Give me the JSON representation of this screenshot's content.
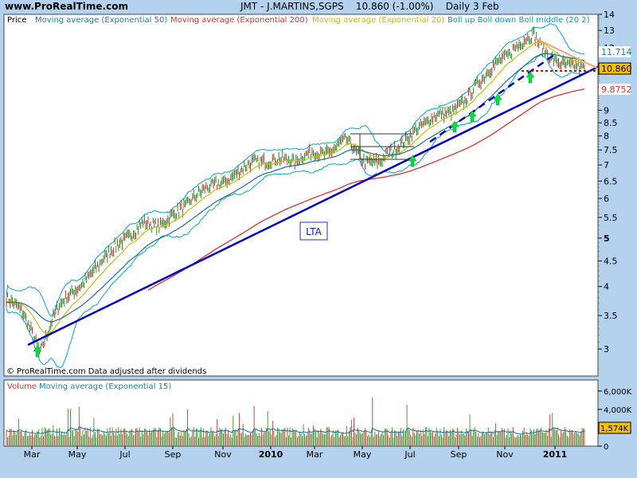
{
  "header": {
    "site": "www.ProRealTime.com",
    "symbol": "JMT - J.MARTINS,SGPS",
    "quote": "10.860 (-1.00%)",
    "period": "Daily 3 Feb"
  },
  "price_panel": {
    "label": "Price",
    "legend": [
      {
        "text": "Moving average (Exponential 50)",
        "color": "#1a7fa6"
      },
      {
        "text": "Moving average (Exponential 200)",
        "color": "#e03030"
      },
      {
        "text": "Moving average (Exponential 20)",
        "color": "#c8c000"
      },
      {
        "text": "Boll up Boll down Boll middle (20 2)",
        "color": "#00a0c0"
      }
    ],
    "annotation": "LTA",
    "footer": "© ProRealTime.com  Data adjusted after dividends",
    "badges": [
      {
        "text": "11.714",
        "color": "#1a7fa6",
        "bg": "#ffffff"
      },
      {
        "text": "10.860",
        "color": "#000000",
        "bg": "#f5c100"
      },
      {
        "text": "9.8752",
        "color": "#e03030",
        "bg": "#ffffff"
      }
    ]
  },
  "volume_panel": {
    "legend": [
      {
        "text": "Volume",
        "color": "#e03030"
      },
      {
        "text": "Moving average (Exponential 15)",
        "color": "#1a7fa6"
      }
    ],
    "badge": "1,574K",
    "y_ticks": [
      "6,000K",
      "4,000K",
      "2,000K",
      "0"
    ]
  },
  "chart_data": {
    "type": "line",
    "y_ticks_major": [
      "14",
      "13",
      "12",
      "11",
      "10",
      "9",
      "8.5",
      "8",
      "7.5",
      "7",
      "6.5",
      "6",
      "5.5",
      "5",
      "4.5",
      "4",
      "3.5",
      "3"
    ],
    "y_ticks_values": [
      14,
      13,
      12,
      11,
      10,
      9,
      8.5,
      8,
      7.5,
      7,
      6.5,
      6,
      5.5,
      5,
      4.5,
      4,
      3.5,
      3
    ],
    "y_scale": "log",
    "x_ticks": [
      "Mar",
      "May",
      "Jul",
      "Sep",
      "Nov",
      "2010",
      "Mar",
      "May",
      "Jul",
      "Sep",
      "Nov",
      "2011"
    ],
    "series": [
      {
        "name": "Moving average (Exponential 50)",
        "values": [
          3.6,
          3.7,
          3.9,
          4.2,
          4.6,
          4.8,
          5.2,
          5.5,
          5.9,
          6.3,
          6.7,
          7.0,
          7.2,
          7.4,
          7.5,
          7.6,
          7.6,
          7.7,
          7.9,
          8.3,
          8.8,
          9.5,
          10.3,
          11.0,
          11.7,
          11.7
        ]
      },
      {
        "name": "Moving average (Exponential 200)",
        "values": [
          4.9,
          5.1,
          5.4,
          5.7,
          6.0,
          6.3,
          6.6,
          6.8,
          6.9,
          7.1,
          7.4,
          7.8,
          8.3,
          8.8,
          9.3,
          9.7,
          9.9
        ]
      },
      {
        "name": "Price",
        "values": [
          3.8,
          3.5,
          3.0,
          3.6,
          3.9,
          4.3,
          4.6,
          5.0,
          5.4,
          5.2,
          5.7,
          6.0,
          6.3,
          6.6,
          6.9,
          7.1,
          7.3,
          7.0,
          7.5,
          7.4,
          7.8,
          7.2,
          7.1,
          7.5,
          8.3,
          8.6,
          8.9,
          9.5,
          10.3,
          11.4,
          12.1,
          12.6,
          11.6,
          11.0,
          10.86
        ]
      }
    ]
  }
}
